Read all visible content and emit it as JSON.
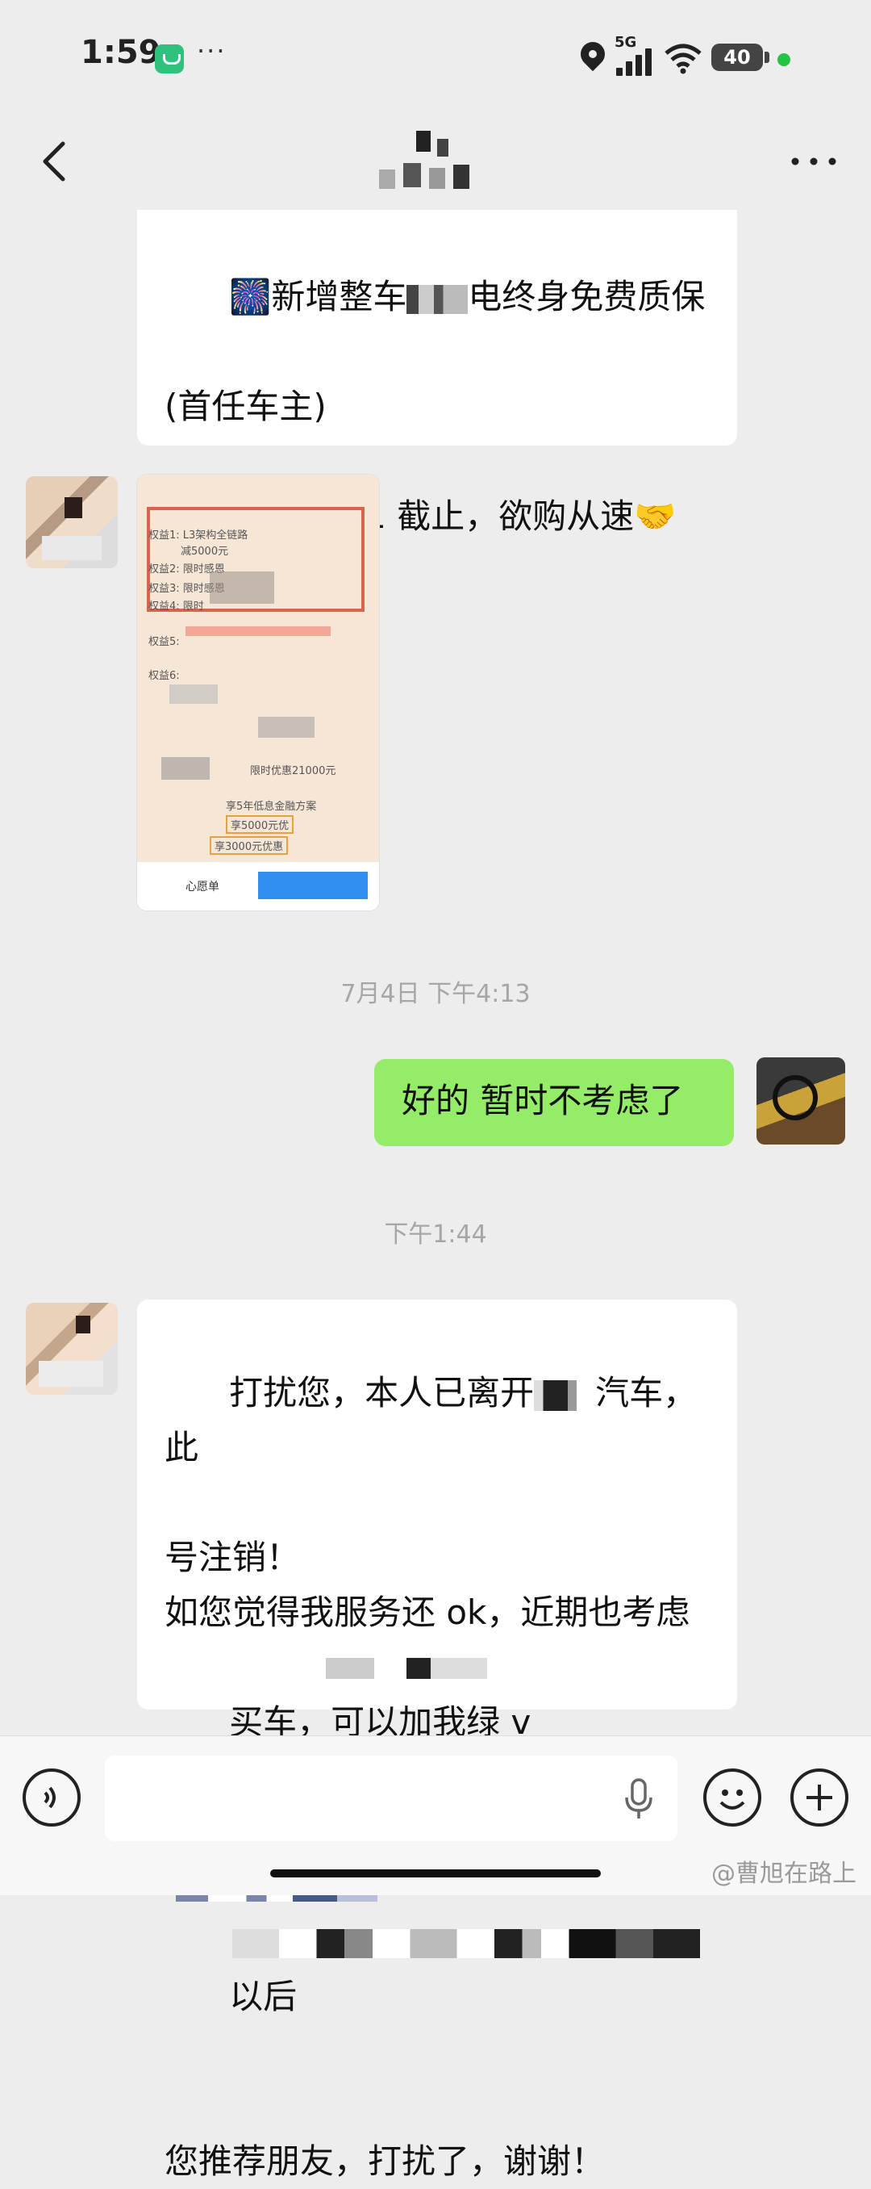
{
  "status_bar": {
    "time": "1:59",
    "overflow": "···",
    "network": "5G",
    "battery": "40",
    "icons": [
      "mi-home-icon",
      "location-icon",
      "signal-icon",
      "wifi-icon",
      "battery-icon"
    ]
  },
  "header": {
    "back_icon": "chevron-left-icon",
    "more_icon": "more-dots-icon"
  },
  "messages": [
    {
      "side": "left",
      "lines_1": "🎆新增整车",
      "lines_1b": "电终身免费质保",
      "line_2": "(首任车主)",
      "line_3": "首销权益 7.31 截止，欲购从速🤝"
    },
    {
      "side": "left",
      "type": "image",
      "img_footer_left": "心愿单",
      "img_rows": [
        "权益1: L3架构全链路",
        "减5000元",
        "权益2: 限时感恩",
        "权益3: 限时感恩",
        "权益4: 限时",
        "权益5:",
        "权益6:",
        "限时优惠21000元",
        "享5年低息金融方案",
        "享5000元优",
        "享3000元优惠"
      ]
    },
    {
      "type": "timestamp",
      "text": "7月4日 下午4:13"
    },
    {
      "side": "right",
      "text": "好的 暂时不考虑了"
    },
    {
      "type": "timestamp",
      "text": "下午1:44"
    },
    {
      "side": "left",
      "l1a": "打扰您，本人已离开",
      "l1b": "汽车，此",
      "l2": "号注销！",
      "l3": "如您觉得我服务还 ok，近期也考虑",
      "l4": "买车，可以加我绿 v",
      "l6": "以后",
      "l7": "您推荐朋友，打扰了，谢谢！"
    }
  ],
  "input_bar": {
    "placeholder": "",
    "icons": [
      "voice-icon",
      "mic-icon",
      "emoji-icon",
      "plus-icon"
    ]
  },
  "watermark": "@曹旭在路上"
}
